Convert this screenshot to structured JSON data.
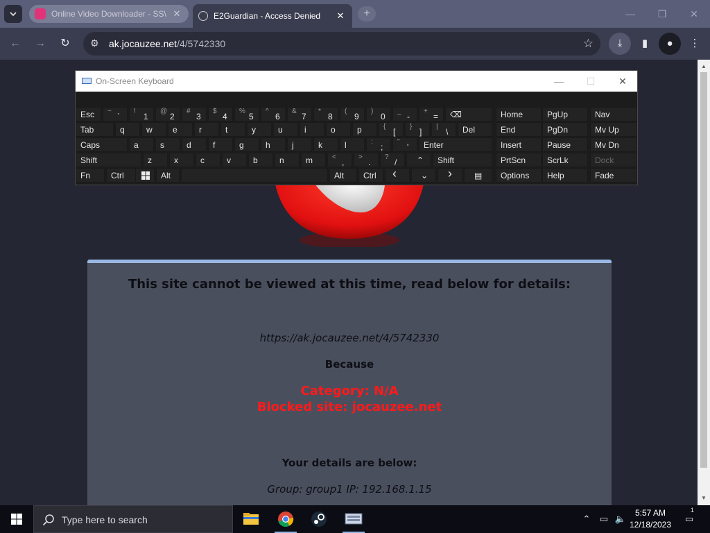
{
  "browser": {
    "tabs": [
      {
        "title": "Online Video Downloader - SS\\",
        "state": "inactive",
        "favicon_color": "#e0337a"
      },
      {
        "title": "E2Guardian - Access Denied",
        "state": "active"
      }
    ],
    "new_tab_label": "+",
    "address": {
      "host": "ak.jocauzee.net",
      "path": "/4/5742330"
    }
  },
  "page": {
    "heading": "This site cannot be viewed at this time, read below for details:",
    "blocked_url": "https://ak.jocauzee.net/4/5742330",
    "because_label": "Because",
    "category": "Category: N/A",
    "blocked_site": "Blocked site: jocauzee.net",
    "details_label": "Your details are below:",
    "group_ip": "Group: group1   IP: 192.168.1.15",
    "accent_color": "#ff1a1a"
  },
  "keyboard": {
    "title": "On-Screen Keyboard",
    "rows": [
      [
        {
          "label": "Esc"
        },
        {
          "shift": "~",
          "low": "`"
        },
        {
          "shift": "!",
          "low": "1"
        },
        {
          "shift": "@",
          "low": "2"
        },
        {
          "shift": "#",
          "low": "3"
        },
        {
          "shift": "$",
          "low": "4"
        },
        {
          "shift": "%",
          "low": "5"
        },
        {
          "shift": "^",
          "low": "6"
        },
        {
          "shift": "&",
          "low": "7"
        },
        {
          "shift": "*",
          "low": "8"
        },
        {
          "shift": "(",
          "low": "9"
        },
        {
          "shift": ")",
          "low": "0"
        },
        {
          "shift": "_",
          "low": "-"
        },
        {
          "shift": "+",
          "low": "="
        },
        {
          "label": "⌫"
        }
      ],
      [
        {
          "label": "Tab"
        },
        {
          "label": "q"
        },
        {
          "label": "w"
        },
        {
          "label": "e"
        },
        {
          "label": "r"
        },
        {
          "label": "t"
        },
        {
          "label": "y"
        },
        {
          "label": "u"
        },
        {
          "label": "i"
        },
        {
          "label": "o"
        },
        {
          "label": "p"
        },
        {
          "shift": "{",
          "low": "["
        },
        {
          "shift": "}",
          "low": "]"
        },
        {
          "shift": "|",
          "low": "\\"
        },
        {
          "label": "Del"
        }
      ],
      [
        {
          "label": "Caps"
        },
        {
          "label": "a"
        },
        {
          "label": "s"
        },
        {
          "label": "d"
        },
        {
          "label": "f"
        },
        {
          "label": "g"
        },
        {
          "label": "h"
        },
        {
          "label": "j"
        },
        {
          "label": "k"
        },
        {
          "label": "l"
        },
        {
          "shift": ":",
          "low": ";"
        },
        {
          "shift": "\"",
          "low": "'"
        },
        {
          "label": "Enter"
        }
      ],
      [
        {
          "label": "Shift"
        },
        {
          "label": "z"
        },
        {
          "label": "x"
        },
        {
          "label": "c"
        },
        {
          "label": "v"
        },
        {
          "label": "b"
        },
        {
          "label": "n"
        },
        {
          "label": "m"
        },
        {
          "shift": "<",
          "low": ","
        },
        {
          "shift": ">",
          "low": "."
        },
        {
          "shift": "?",
          "low": "/"
        },
        {
          "label": "^"
        },
        {
          "label": "Shift"
        }
      ],
      [
        {
          "label": "Fn"
        },
        {
          "label": "Ctrl"
        },
        {
          "label": "win-logo-icon"
        },
        {
          "label": "Alt"
        },
        {
          "label": ""
        },
        {
          "label": "Alt"
        },
        {
          "label": "Ctrl"
        },
        {
          "label": "<"
        },
        {
          "label": "v"
        },
        {
          "label": ">"
        },
        {
          "label": "menu-icon"
        }
      ]
    ],
    "nav_keys": [
      [
        "Home",
        "PgUp",
        "Nav"
      ],
      [
        "End",
        "PgDn",
        "Mv Up"
      ],
      [
        "Insert",
        "Pause",
        "Mv Dn"
      ],
      [
        "PrtScn",
        "ScrLk",
        "Dock"
      ],
      [
        "Options",
        "Help",
        "Fade"
      ]
    ]
  },
  "taskbar": {
    "search_placeholder": "Type here to search",
    "time": "5:57 AM",
    "date": "12/18/2023",
    "notifications": "1"
  }
}
